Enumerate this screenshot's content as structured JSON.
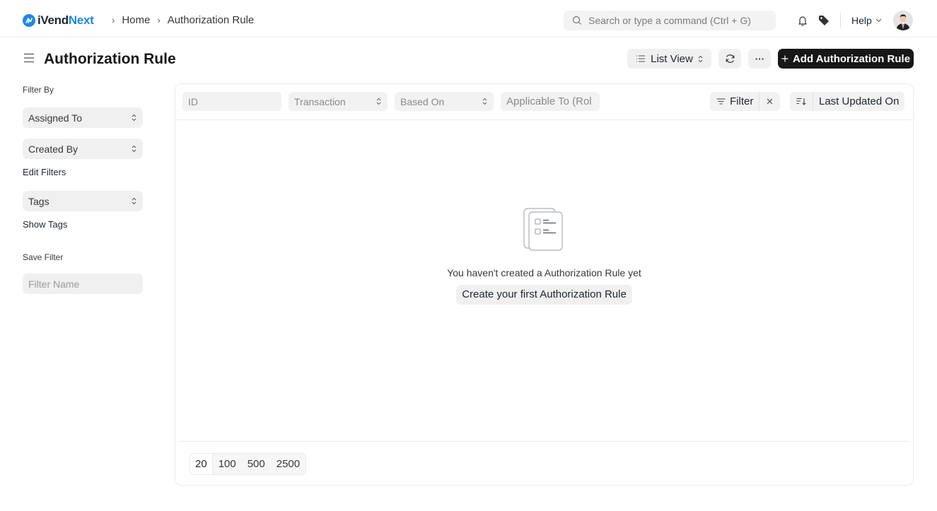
{
  "app": {
    "brand_a": "iVend",
    "brand_b": "Next"
  },
  "breadcrumb": [
    "Home",
    "Authorization Rule"
  ],
  "search": {
    "placeholder": "Search or type a command (Ctrl + G)"
  },
  "navbar": {
    "help_label": "Help",
    "icons": [
      "bell-icon",
      "tag-icon",
      "avatar"
    ]
  },
  "page": {
    "title": "Authorization Rule",
    "view_label": "List View",
    "add_button": "Add Authorization Rule"
  },
  "sidebar": {
    "filter_by": "Filter By",
    "assigned_to": "Assigned To",
    "created_by": "Created By",
    "edit_filters": "Edit Filters",
    "tags": "Tags",
    "show_tags": "Show Tags",
    "save_filter": "Save Filter",
    "filter_name_placeholder": "Filter Name"
  },
  "filters": {
    "id_placeholder": "ID",
    "transaction": "Transaction",
    "based_on": "Based On",
    "applicable_to": "Applicable To (Rol",
    "filter_label": "Filter",
    "sort_label": "Last Updated On"
  },
  "empty_state": {
    "message": "You haven't created a Authorization Rule yet",
    "button": "Create your first Authorization Rule"
  },
  "pagination": {
    "options": [
      "20",
      "100",
      "500",
      "2500"
    ],
    "selected": "20"
  }
}
